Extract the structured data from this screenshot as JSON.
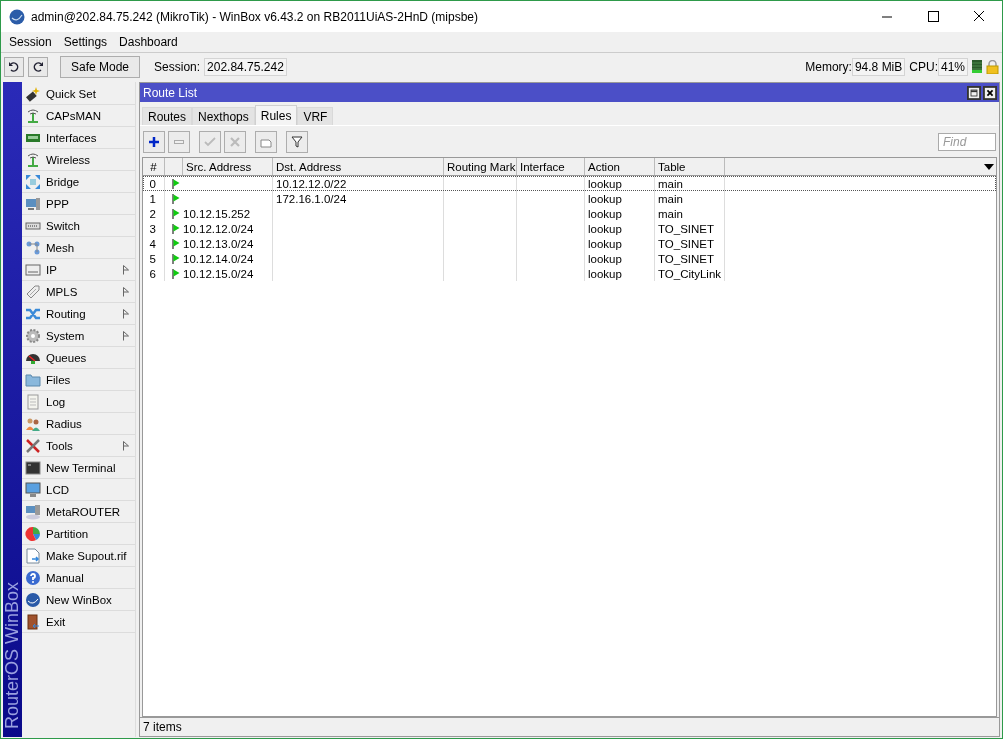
{
  "window": {
    "title": "admin@202.84.75.242 (MikroTik) - WinBox v6.43.2 on RB2011UiAS-2HnD (mipsbe)"
  },
  "menu": [
    "Session",
    "Settings",
    "Dashboard"
  ],
  "toolbar": {
    "safe_mode": "Safe Mode",
    "session_label": "Session:",
    "session": "202.84.75.242",
    "memory_label": "Memory:",
    "memory": "94.8 MiB",
    "cpu_label": "CPU:",
    "cpu": "41%"
  },
  "brand": "RouterOS WinBox",
  "sidebar": {
    "items": [
      {
        "label": "Quick Set",
        "submenu": false
      },
      {
        "label": "CAPsMAN",
        "submenu": false
      },
      {
        "label": "Interfaces",
        "submenu": false
      },
      {
        "label": "Wireless",
        "submenu": false
      },
      {
        "label": "Bridge",
        "submenu": false
      },
      {
        "label": "PPP",
        "submenu": false
      },
      {
        "label": "Switch",
        "submenu": false
      },
      {
        "label": "Mesh",
        "submenu": false
      },
      {
        "label": "IP",
        "submenu": true
      },
      {
        "label": "MPLS",
        "submenu": true
      },
      {
        "label": "Routing",
        "submenu": true
      },
      {
        "label": "System",
        "submenu": true
      },
      {
        "label": "Queues",
        "submenu": false
      },
      {
        "label": "Files",
        "submenu": false
      },
      {
        "label": "Log",
        "submenu": false
      },
      {
        "label": "Radius",
        "submenu": false
      },
      {
        "label": "Tools",
        "submenu": true
      },
      {
        "label": "New Terminal",
        "submenu": false
      },
      {
        "label": "LCD",
        "submenu": false
      },
      {
        "label": "MetaROUTER",
        "submenu": false
      },
      {
        "label": "Partition",
        "submenu": false
      },
      {
        "label": "Make Supout.rif",
        "submenu": false
      },
      {
        "label": "Manual",
        "submenu": false
      },
      {
        "label": "New WinBox",
        "submenu": false
      },
      {
        "label": "Exit",
        "submenu": false
      }
    ]
  },
  "route_list": {
    "title": "Route List",
    "tabs": [
      {
        "label": "Routes",
        "selected": false
      },
      {
        "label": "Nexthops",
        "selected": false
      },
      {
        "label": "Rules",
        "selected": true
      },
      {
        "label": "VRF",
        "selected": false
      }
    ],
    "find": {
      "placeholder": "Find"
    },
    "table": {
      "columns": [
        "#",
        "",
        "Src. Address",
        "Dst. Address",
        "Routing Mark",
        "Interface",
        "Action",
        "Table"
      ],
      "rows": [
        {
          "number": "0",
          "src_address": "",
          "dst_address": "10.12.12.0/22",
          "action": "lookup",
          "table": "main",
          "focused": true
        },
        {
          "number": "1",
          "src_address": "",
          "dst_address": "172.16.1.0/24",
          "action": "lookup",
          "table": "main",
          "focused": false
        },
        {
          "number": "2",
          "src_address": "10.12.15.252",
          "dst_address": "",
          "action": "lookup",
          "table": "main",
          "focused": false
        },
        {
          "number": "3",
          "src_address": "10.12.12.0/24",
          "dst_address": "",
          "action": "lookup",
          "table": "TO_SINET",
          "focused": false
        },
        {
          "number": "4",
          "src_address": "10.12.13.0/24",
          "dst_address": "",
          "action": "lookup",
          "table": "TO_SINET",
          "focused": false
        },
        {
          "number": "5",
          "src_address": "10.12.14.0/24",
          "dst_address": "",
          "action": "lookup",
          "table": "TO_SINET",
          "focused": false
        },
        {
          "number": "6",
          "src_address": "10.12.15.0/24",
          "dst_address": "",
          "action": "lookup",
          "table": "TO_CityLink",
          "focused": false
        }
      ]
    },
    "status": "7 items"
  }
}
